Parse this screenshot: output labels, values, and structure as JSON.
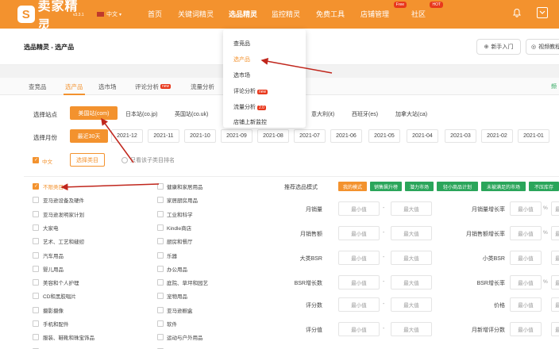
{
  "header": {
    "logo_mark": "S",
    "logo_text": "卖家精灵",
    "version": "v3.3.1",
    "language": "中文",
    "nav": [
      "首页",
      "关键词精灵",
      "选品精灵",
      "监控精灵",
      "免费工具",
      "店铺管理",
      "社区"
    ],
    "badge_free": "Free",
    "badge_hot": "HOT",
    "accent_color": "#f3922e"
  },
  "breadcrumb": "选品精灵 - 选产品",
  "guide_button": "新手入门",
  "video_button": "视频教程",
  "tabs": [
    "查竞品",
    "选产品",
    "选市场",
    "评论分析",
    "流量分析"
  ],
  "tab_new": "new",
  "tab_right_fragment": "频",
  "dropdown": {
    "items": [
      "查竞品",
      "选产品",
      "选市场",
      "评论分析",
      "流量分析",
      "店铺上新监控"
    ],
    "new_tag": "new",
    "flow_tag": "2.0"
  },
  "site": {
    "label": "选择站点",
    "options": [
      "美国站(com)",
      "日本站(co.jp)",
      "英国站(co.uk)",
      "意大利(it)",
      "西班牙(es)",
      "加拿大站(ca)"
    ]
  },
  "month": {
    "label": "选择月份",
    "options": [
      "最近30天",
      "2021-12",
      "2021-11",
      "2021-10",
      "2021-09",
      "2021-08",
      "2021-07",
      "2021-06",
      "2021-05",
      "2021-04",
      "2021-03",
      "2021-02",
      "2021-01"
    ]
  },
  "category_filter": {
    "lang": "中文",
    "select_button": "选择类目",
    "only_hint": "只看该子类目排名"
  },
  "categories_left": [
    "不限类目",
    "亚马逊设备及硬件",
    "亚马逊发明家计划",
    "大家电",
    "艺术、工艺和缝纫",
    "汽车用品",
    "婴儿用品",
    "美容和个人护理",
    "CD和黑胶唱片",
    "摄影摄像",
    "手机和配件",
    "服装、鞋靴和珠宝饰品",
    "计算机及配件"
  ],
  "categories_right": [
    "健康和家居用品",
    "家居厨房用品",
    "工业和科学",
    "Kindle商店",
    "厨房和餐厅",
    "乐器",
    "办公用品",
    "庭院、草坪和园艺",
    "宠物用品",
    "亚马逊橱盒",
    "软件",
    "运动与户外用品",
    "体育收藏品"
  ],
  "mode": {
    "label": "推荐选品模式",
    "options": [
      "我的模式",
      "销售飙升榜",
      "潜力市场",
      "轻小商品计划",
      "未被满足的市场",
      "不压库存"
    ]
  },
  "form": {
    "min": "最小值",
    "max": "最大值",
    "dash": "-",
    "pct": "%",
    "left_labels": [
      "月销量",
      "月销售额",
      "大类BSR",
      "BSR增长数",
      "评分数",
      "评分值"
    ],
    "right_labels": [
      "月销量增长率",
      "月销售额增长率",
      "小类BSR",
      "BSR增长率",
      "价格",
      "月新增评分数"
    ]
  }
}
